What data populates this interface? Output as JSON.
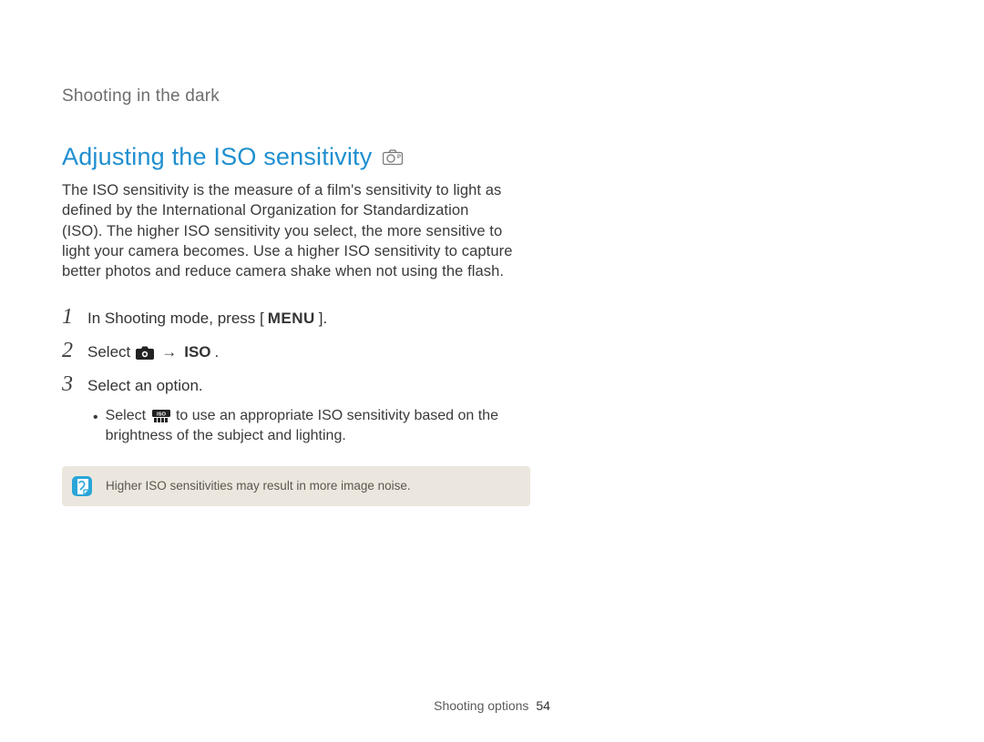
{
  "breadcrumb": "Shooting in the dark",
  "heading": "Adjusting the ISO sensitivity",
  "heading_mode_icon": "camera-p-mode-icon",
  "body": "The ISO sensitivity is the measure of a film's sensitivity to light as defined by the International Organization for Standardization (ISO). The higher ISO sensitivity you select, the more sensitive to light your camera becomes. Use a higher ISO sensitivity to capture better photos and reduce camera shake when not using the flash.",
  "steps": [
    {
      "num": "1",
      "pre": "In Shooting mode, press [",
      "icon": "menu-icon",
      "icon_text": "MENU",
      "post": "]."
    },
    {
      "num": "2",
      "pre": "Select ",
      "icon": "camera-icon",
      "arrow": "→",
      "bold_post": "ISO",
      "post": "."
    },
    {
      "num": "3",
      "pre": "Select an option."
    }
  ],
  "sub": {
    "bullet": "•",
    "pre": "Select ",
    "icon": "iso-auto-icon",
    "post": " to use an appropriate ISO sensitivity based on the brightness of the subject and lighting."
  },
  "note": {
    "icon": "note-icon",
    "text": "Higher ISO sensitivities may result in more image noise."
  },
  "footer": {
    "section": "Shooting options",
    "page": "54"
  }
}
